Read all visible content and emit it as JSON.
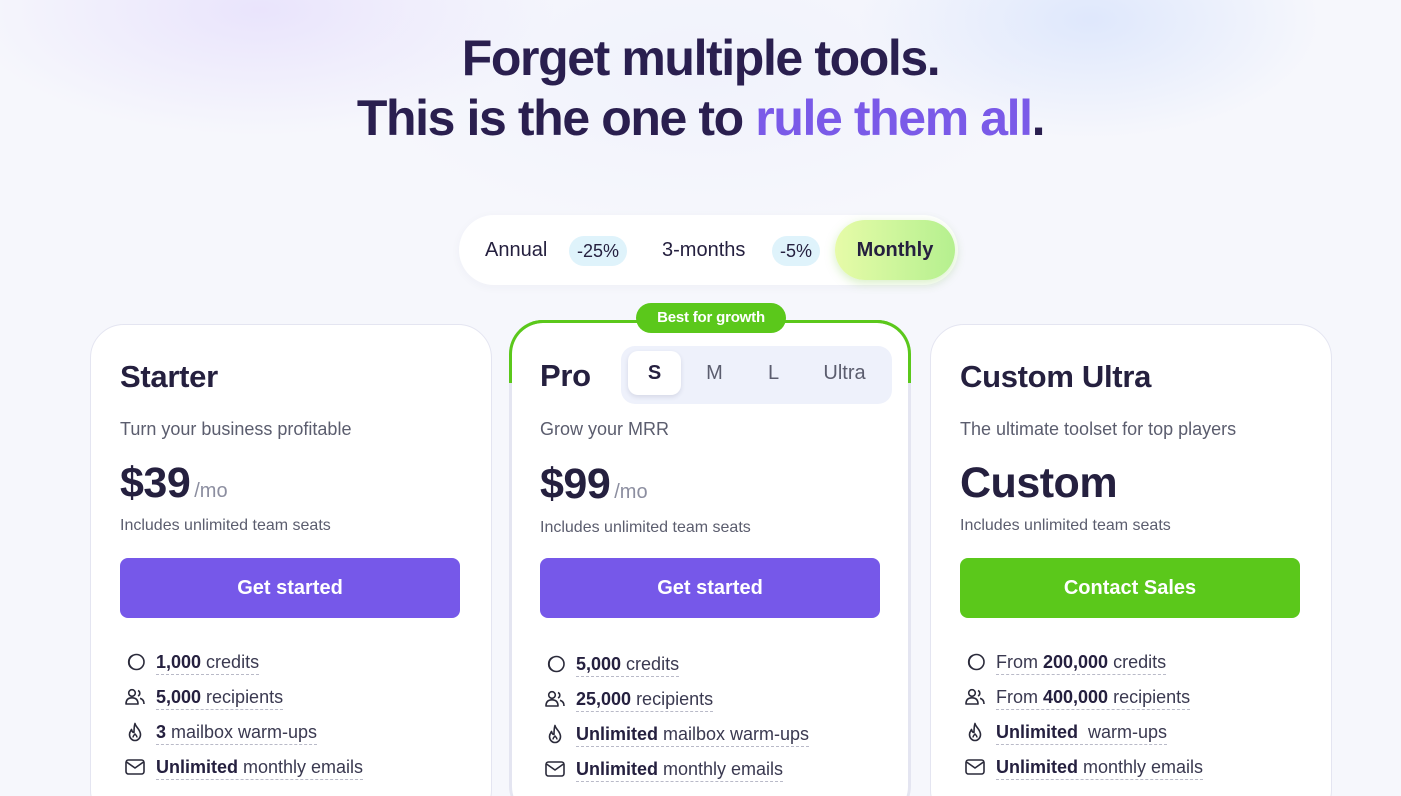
{
  "headline": {
    "line1": "Forget multiple tools.",
    "line2_prefix": "This is the one to ",
    "line2_accent": "rule them all",
    "line2_suffix": "."
  },
  "billing": {
    "options": [
      {
        "label": "Annual",
        "discount": "-25%"
      },
      {
        "label": "3-months",
        "discount": "-5%"
      },
      {
        "label": "Monthly",
        "discount": ""
      }
    ],
    "selected": "Monthly"
  },
  "colors": {
    "brand_purple": "#7658e9",
    "brand_green": "#5bc81b",
    "accent_text": "#7a5ae8",
    "heading": "#2a1f4f"
  },
  "plans": [
    {
      "name": "Starter",
      "description": "Turn your business profitable",
      "price": "$39",
      "period": "/mo",
      "seats": "Includes unlimited team seats",
      "cta": "Get started",
      "features": [
        {
          "icon": "credits-icon",
          "bold": "1,000",
          "text": " credits"
        },
        {
          "icon": "recipients-icon",
          "bold": "5,000",
          "text": " recipients"
        },
        {
          "icon": "flame-icon",
          "bold": "3",
          "text": " mailbox warm-ups"
        },
        {
          "icon": "mail-icon",
          "bold": "Unlimited",
          "text": " monthly emails"
        }
      ]
    },
    {
      "name": "Pro",
      "badge": "Best for growth",
      "sizes": [
        "S",
        "M",
        "L",
        "Ultra"
      ],
      "selected_size": "S",
      "description": "Grow your MRR",
      "price": "$99",
      "period": "/mo",
      "seats": "Includes unlimited team seats",
      "cta": "Get started",
      "features": [
        {
          "icon": "credits-icon",
          "bold": "5,000",
          "text": " credits"
        },
        {
          "icon": "recipients-icon",
          "bold": "25,000",
          "text": " recipients"
        },
        {
          "icon": "flame-icon",
          "bold": "Unlimited",
          "text": " mailbox warm-ups"
        },
        {
          "icon": "mail-icon",
          "bold": "Unlimited",
          "text": " monthly emails"
        }
      ]
    },
    {
      "name": "Custom Ultra",
      "description": "The ultimate toolset for top players",
      "price": "Custom",
      "seats": "Includes unlimited team seats",
      "cta": "Contact Sales",
      "features": [
        {
          "icon": "credits-icon",
          "prefix": "From ",
          "bold": "200,000",
          "text": " credits"
        },
        {
          "icon": "recipients-icon",
          "prefix": "From ",
          "bold": "400,000",
          "text": " recipients"
        },
        {
          "icon": "flame-icon",
          "bold": "Unlimited",
          "text": "  warm-ups"
        },
        {
          "icon": "mail-icon",
          "bold": "Unlimited",
          "text": " monthly emails"
        }
      ]
    }
  ]
}
